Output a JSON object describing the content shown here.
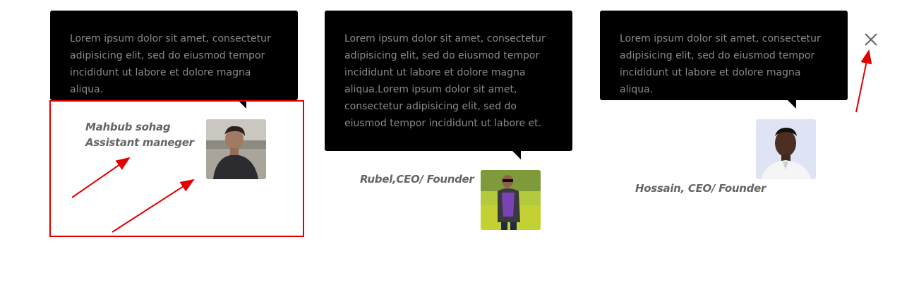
{
  "testimonials": [
    {
      "quote": "Lorem ipsum dolor sit amet, consectetur adipisicing elit, sed do eiusmod tempor incididunt ut labore et dolore magna aliqua.",
      "name_line1": "Mahbub sohag",
      "name_line2": "Assistant maneger"
    },
    {
      "quote": "Lorem ipsum dolor sit amet, consectetur adipisicing elit, sed do eiusmod tempor incididunt ut labore et dolore magna aliqua.Lorem ipsum dolor sit amet, consectetur adipisicing elit, sed do eiusmod tempor incididunt ut labore et.",
      "name_line1": "Rubel,CEO/ Founder"
    },
    {
      "quote": "Lorem ipsum dolor sit amet, consectetur adipisicing elit, sed do eiusmod tempor incididunt ut labore et dolore magna aliqua.",
      "name_line1": "Hossain, CEO/ Founder"
    }
  ],
  "close_icon": "close-icon",
  "colors": {
    "bubble_bg": "#000000",
    "quote_text": "#8a8a8a",
    "name_text": "#666666",
    "annotation_red": "#e00000"
  }
}
